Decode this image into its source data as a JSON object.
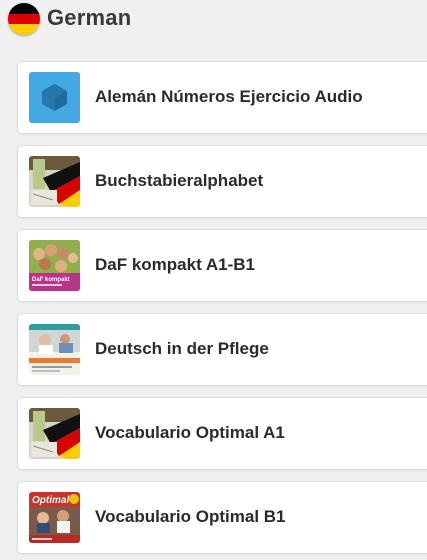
{
  "header": {
    "title": "German",
    "flag_icon": "germany-flag-icon",
    "flag_colors": [
      "#000000",
      "#dd0000",
      "#ffce00"
    ]
  },
  "items": [
    {
      "label": "Alemán Números Ejercicio Audio",
      "icon": "app-cube-icon",
      "accent": "#3aa4e0"
    },
    {
      "label": "Buchstabieralphabet",
      "icon": "german-flag-book-thumbnail"
    },
    {
      "label": "DaF kompakt A1-B1",
      "icon": "daf-kompakt-cover-thumbnail",
      "cover_text": "DaF kompakt"
    },
    {
      "label": "Deutsch in der Pflege",
      "icon": "pflege-cover-thumbnail"
    },
    {
      "label": "Vocabulario Optimal A1",
      "icon": "german-flag-book-thumbnail"
    },
    {
      "label": "Vocabulario Optimal B1",
      "icon": "optimal-cover-thumbnail",
      "cover_text": "Optimal"
    }
  ]
}
